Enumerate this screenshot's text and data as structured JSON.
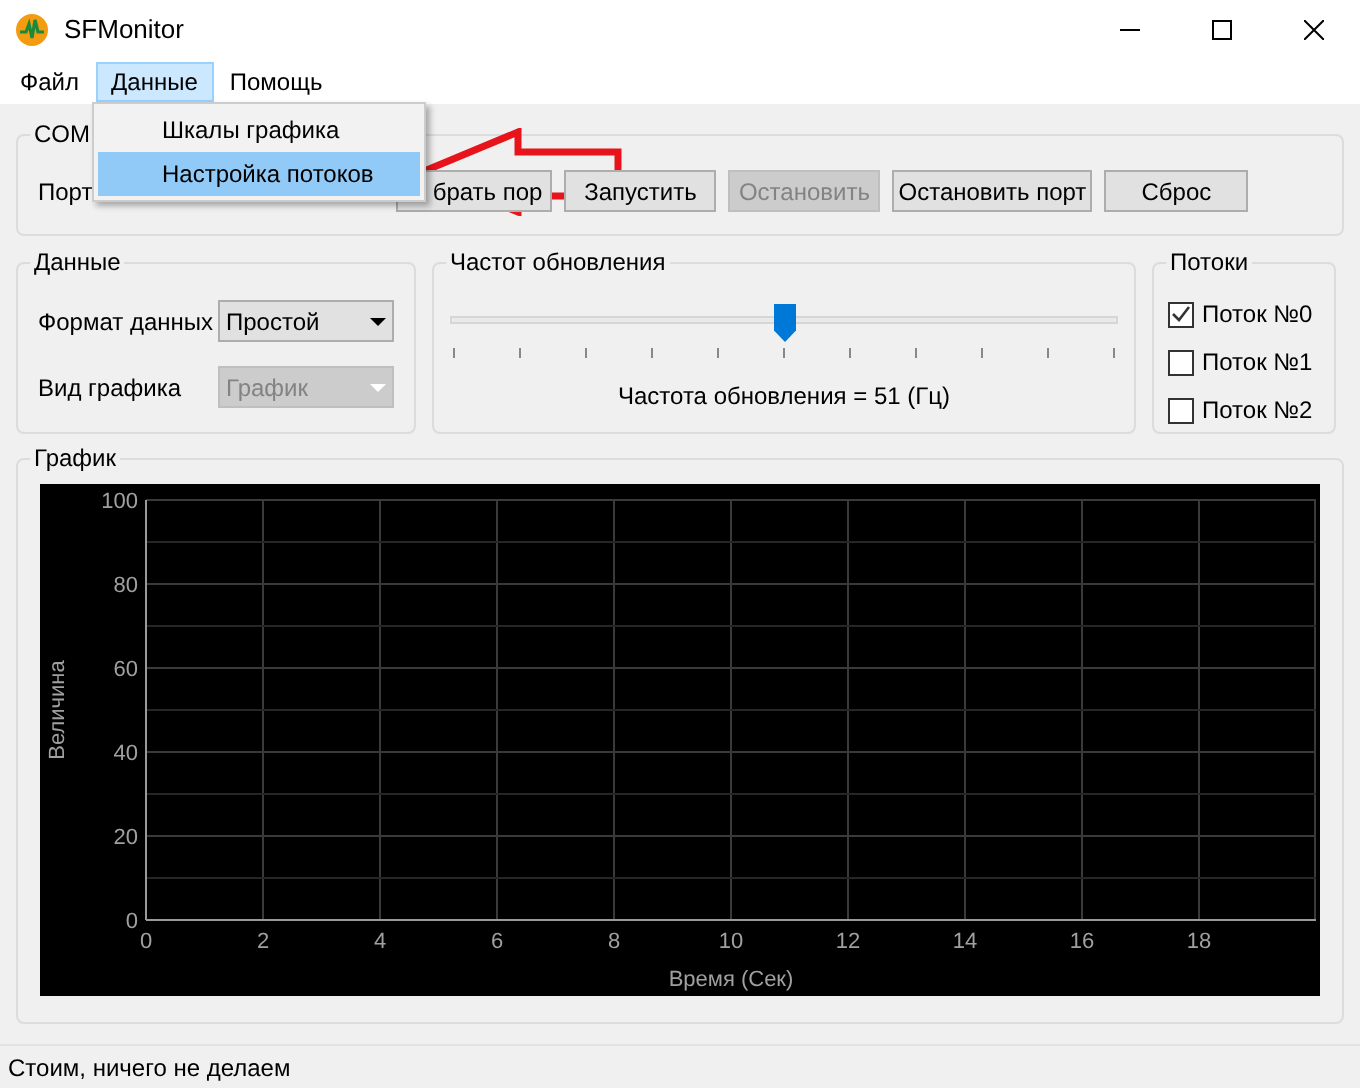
{
  "window": {
    "title": "SFMonitor"
  },
  "menu": [
    {
      "label": "Файл",
      "selected": false
    },
    {
      "label": "Данные",
      "selected": true
    },
    {
      "label": "Помощь",
      "selected": false
    }
  ],
  "dropdown": [
    {
      "label": "Шкалы графика",
      "selected": false
    },
    {
      "label": "Настройка потоков",
      "selected": true
    }
  ],
  "com_group": {
    "title": "COM",
    "port_label": "Порт",
    "buttons": [
      {
        "label": "брать пор",
        "disabled": false
      },
      {
        "label": "Запустить",
        "disabled": false
      },
      {
        "label": "Остановить",
        "disabled": true
      },
      {
        "label": "Остановить порт",
        "disabled": false
      },
      {
        "label": "Сброс",
        "disabled": false
      }
    ]
  },
  "data_group": {
    "title": "Данные",
    "fields": [
      {
        "label": "Формат данных",
        "value": "Простой",
        "disabled": false
      },
      {
        "label": "Вид графика",
        "value": "График",
        "disabled": true
      }
    ]
  },
  "rate_group": {
    "title": "Частот обновления",
    "level": 0.5,
    "reading": "Частота обновления = 51 (Гц)"
  },
  "streams_group": {
    "title": "Потоки",
    "items": [
      {
        "label": "Поток №0",
        "checked": true
      },
      {
        "label": "Поток №1",
        "checked": false
      },
      {
        "label": "Поток №2",
        "checked": false
      }
    ]
  },
  "graph_group": {
    "title": "График",
    "chart_data": {
      "type": "line",
      "xlabel": "Время (Сек)",
      "ylabel": "Величина",
      "xlim": [
        0,
        20
      ],
      "ylim": [
        0,
        100
      ],
      "xticks": [
        0,
        2,
        4,
        6,
        8,
        10,
        12,
        14,
        16,
        18
      ],
      "yticks": [
        0,
        20,
        40,
        60,
        80,
        100
      ],
      "grid": true
    }
  },
  "status_bar": "Стоим, ничего не делаем"
}
